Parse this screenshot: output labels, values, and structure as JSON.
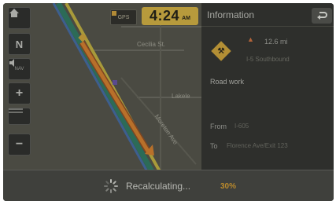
{
  "map": {
    "street_labels": [
      "Cecilia St.",
      "Lakele",
      "Moreton Ave"
    ],
    "controls": {
      "home_icon": "home-icon",
      "north_label": "N",
      "nav_label": "NAV",
      "speaker_icon": "speaker-icon",
      "zoom_in_label": "+",
      "zoom_out_label": "−"
    }
  },
  "status": {
    "gps_label": "GPS",
    "time": "4:24",
    "ampm": "AM"
  },
  "info_panel": {
    "title": "Information",
    "back_icon": "back-icon",
    "sign_icon": "road-work-sign-icon",
    "distance": "12.6 mi",
    "route": "I-5 Southbound",
    "incident": "Road work",
    "from_label": "From",
    "from_value": "I-605",
    "to_label": "To",
    "to_value": "Florence Ave/Exit 123"
  },
  "recalculating": {
    "label": "Recalculating...",
    "percent": "30%",
    "progress": 0.3
  },
  "colors": {
    "accent": "#b9892c",
    "route_orange": "#b8702a",
    "highway_yellow": "#a89a3a"
  }
}
